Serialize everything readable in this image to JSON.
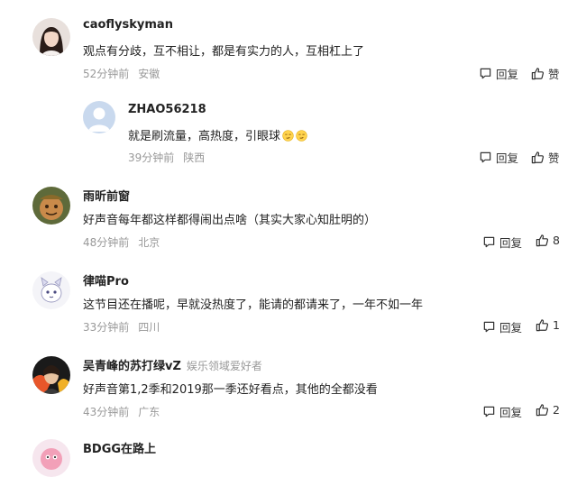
{
  "actions": {
    "reply_label": "回复",
    "like_label": "赞"
  },
  "comments": [
    {
      "user": "caoflyskyman",
      "text": "观点有分歧，互不相让，都是有实力的人，互相杠上了",
      "time": "52分钟前",
      "location": "安徽",
      "likes": ""
    },
    {
      "user": "ZHAO56218",
      "text": "就是刷流量，高热度，引眼球",
      "time": "39分钟前",
      "location": "陕西",
      "likes": "",
      "emojis": [
        "smirk-face",
        "smirk-face"
      ]
    },
    {
      "user": "雨昕前窗",
      "text": "好声音每年都这样都得闹出点啥（其实大家心知肚明的）",
      "time": "48分钟前",
      "location": "北京",
      "likes": "8"
    },
    {
      "user": "律喵Pro",
      "text": "这节目还在播呢，早就没热度了，能请的都请来了，一年不如一年",
      "time": "33分钟前",
      "location": "四川",
      "likes": "1"
    },
    {
      "user": "吴青峰的苏打绿vZ",
      "badge": "娱乐领域爱好者",
      "text": "好声音第1,2季和2019那一季还好看点，其他的全都没看",
      "time": "43分钟前",
      "location": "广东",
      "likes": "2"
    },
    {
      "user": "BDGG在路上"
    }
  ]
}
